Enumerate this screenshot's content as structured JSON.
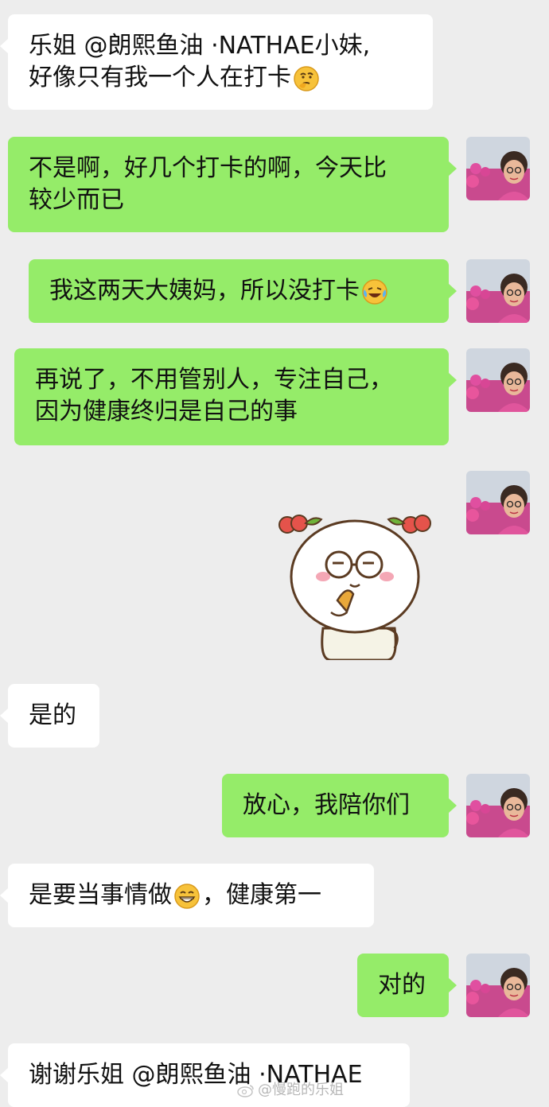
{
  "messages": [
    {
      "side": "left",
      "lines": [
        "乐姐 @朗熙鱼油 ·NATHAE小妹,",
        "好像只有我一个人在打卡"
      ],
      "emoji": "thinking-face"
    },
    {
      "side": "right",
      "lines": [
        "不是啊，好几个打卡的啊，今天比",
        "较少而已"
      ]
    },
    {
      "side": "right",
      "lines": [
        "我这两天大姨妈，所以没打卡"
      ],
      "emoji": "crying-laughing-face"
    },
    {
      "side": "right",
      "lines": [
        "再说了，不用管别人，专注自己，",
        "因为健康终归是自己的事"
      ]
    },
    {
      "side": "right",
      "sticker": "cartoon-bun-with-glasses-eating"
    },
    {
      "side": "left",
      "lines": [
        "是的"
      ]
    },
    {
      "side": "right",
      "lines": [
        "放心，我陪你们"
      ]
    },
    {
      "side": "left",
      "lines": [
        "是要当事情做",
        "，健康第一"
      ],
      "emoji": "grinning-face"
    },
    {
      "side": "right",
      "lines": [
        "对的"
      ]
    },
    {
      "side": "left",
      "lines": [
        "谢谢乐姐 @朗熙鱼油 ·NATHAE"
      ]
    }
  ],
  "watermark": "@慢跑的乐姐",
  "colors": {
    "background": "#ededed",
    "left_bubble": "#ffffff",
    "right_bubble": "#95ec69"
  }
}
